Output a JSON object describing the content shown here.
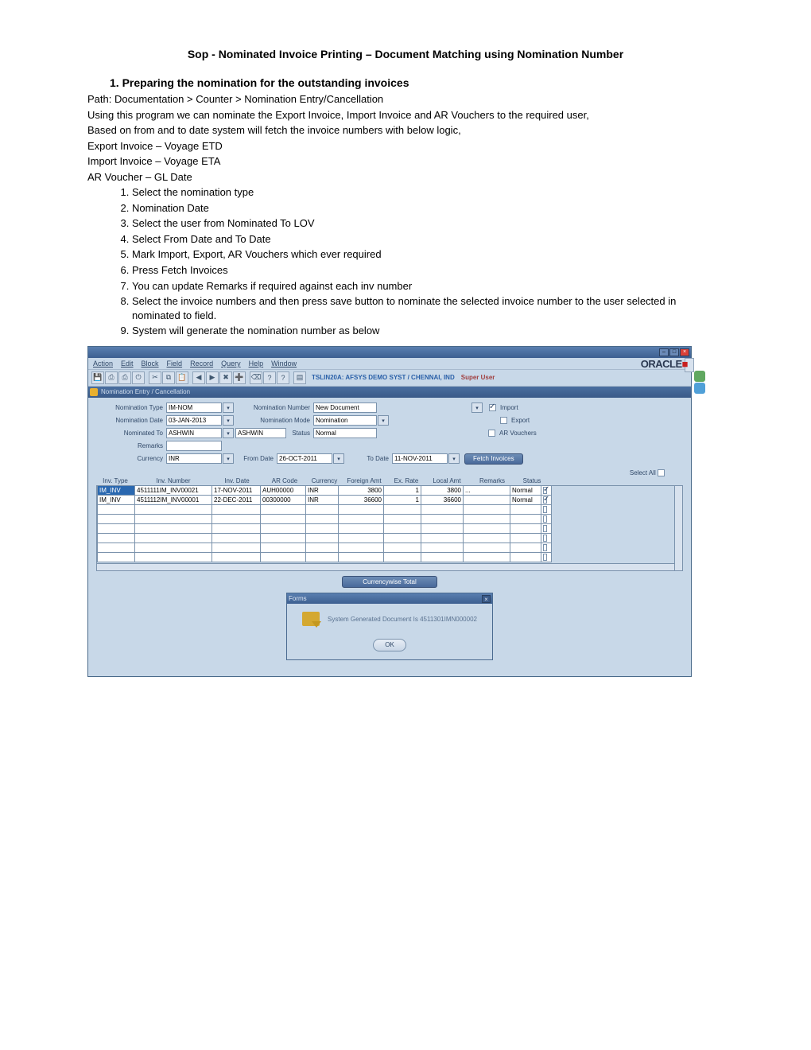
{
  "doc": {
    "title": "Sop - Nominated Invoice Printing – Document Matching using Nomination Number",
    "section1_heading": "1.  Preparing the nomination for the outstanding invoices",
    "path_line": "Path: Documentation > Counter > Nomination Entry/Cancellation",
    "para1": "Using this program we can nominate the Export Invoice, Import Invoice and AR Vouchers to the required user,",
    "para2": "Based on from and to date system will fetch the invoice numbers with below logic,",
    "line_exp": "Export Invoice – Voyage ETD",
    "line_imp": "Import Invoice – Voyage ETA",
    "line_ar": "AR Voucher – GL Date",
    "steps": [
      "Select the nomination type",
      "Nomination Date",
      "Select the user from Nominated To LOV",
      "Select From Date and To Date",
      "Mark Import, Export, AR Vouchers which ever required",
      "Press Fetch Invoices",
      "You can update Remarks if required against each inv number",
      "Select the invoice numbers and then press save button to nominate the selected invoice number to the user selected in nominated to field.",
      "System will generate the nomination number as below"
    ]
  },
  "app": {
    "menus": [
      "Action",
      "Edit",
      "Block",
      "Field",
      "Record",
      "Query",
      "Help",
      "Window"
    ],
    "toolbar_context": "TSLIN20A:  AFSYS DEMO SYST / CHENNAI, IND",
    "toolbar_user": "Super User",
    "inner_title": "Nomination Entry / Cancellation",
    "oracle": "ORACLE",
    "form": {
      "nom_type_lbl": "Nomination Type",
      "nom_type_val": "IM-NOM",
      "nom_date_lbl": "Nomination Date",
      "nom_date_val": "03-JAN-2013",
      "nom_to_lbl": "Nominated To",
      "nom_to_val": "ASHWIN",
      "nom_to_disp": "ASHWIN",
      "remarks_lbl": "Remarks",
      "remarks_val": "",
      "currency_lbl": "Currency",
      "currency_val": "INR",
      "from_date_lbl": "From Date",
      "from_date_val": "26-OCT-2011",
      "to_date_lbl": "To Date",
      "to_date_val": "11-NOV-2011",
      "nom_num_lbl": "Nomination Number",
      "nom_num_val": "New Document",
      "nom_mode_lbl": "Nomination Mode",
      "nom_mode_val": "Nomination",
      "status_lbl": "Status",
      "status_val": "Normal",
      "chk_import": "Import",
      "chk_export": "Export",
      "chk_ar": "AR Vouchers",
      "fetch_btn": "Fetch Invoices"
    },
    "grid": {
      "select_all": "Select All",
      "headers": {
        "inv_type": "Inv. Type",
        "inv_number": "Inv. Number",
        "inv_date": "Inv. Date",
        "ar_code": "AR Code",
        "currency": "Currency",
        "foreign_amt": "Foreign Amt",
        "ex_rate": "Ex. Rate",
        "local_amt": "Local Amt",
        "remarks": "Remarks",
        "status": "Status"
      },
      "rows": [
        {
          "inv_type": "IM_INV",
          "inv_number": "4511111IM_INV00021",
          "inv_date": "17-NOV-2011",
          "ar_code": "AUH00000",
          "currency": "INR",
          "foreign_amt": "3800",
          "ex_rate": "1",
          "local_amt": "3800",
          "remarks": "...",
          "status": "Normal"
        },
        {
          "inv_type": "IM_INV",
          "inv_number": "4511112IM_INV00001",
          "inv_date": "22-DEC-2011",
          "ar_code": "00300000",
          "currency": "INR",
          "foreign_amt": "36600",
          "ex_rate": "1",
          "local_amt": "36600",
          "remarks": "",
          "status": "Normal"
        }
      ]
    },
    "currency_total_btn": "Currencywise Total",
    "dialog": {
      "title": "Forms",
      "message": "System Generated Document Is  4511301IMN000002",
      "ok": "OK"
    }
  }
}
